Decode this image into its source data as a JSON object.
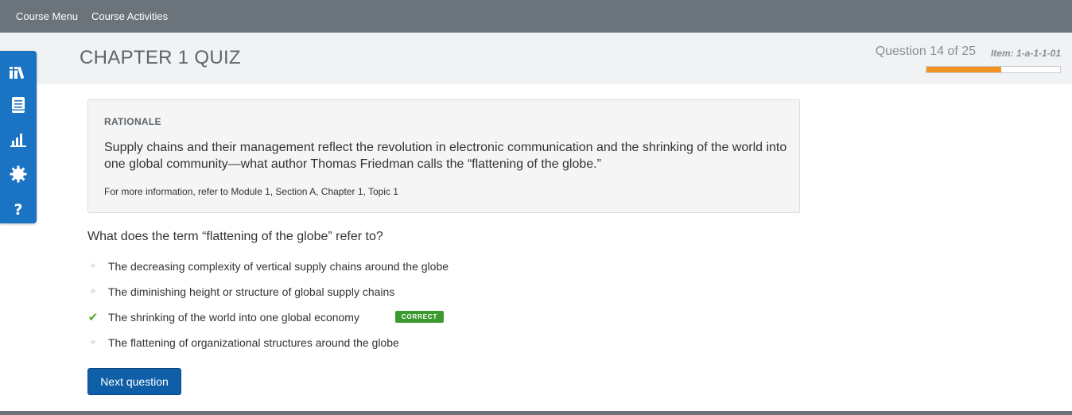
{
  "nav": {
    "course_menu": "Course Menu",
    "course_activities": "Course Activities"
  },
  "header": {
    "title": "CHAPTER 1 QUIZ",
    "progress_text": "Question 14 of 25",
    "item_id": "Item: 1-a-1-1-01",
    "progress_fraction": 0.56,
    "progress_color": "#f39220"
  },
  "sidebar": {
    "icons": [
      "library-icon",
      "notebook-icon",
      "bar-chart-icon",
      "gear-icon",
      "help-icon"
    ],
    "accent": "#1a73c3"
  },
  "rationale": {
    "heading": "RATIONALE",
    "body": "Supply chains and their management reflect the revolution in electronic communication and the shrinking of the world into one global community—what author Thomas Friedman calls the “flattening of the globe.”",
    "reference": "For more information, refer to Module 1, Section A, Chapter 1, Topic 1"
  },
  "question": {
    "text": "What does the term “flattening of the globe” refer to?",
    "answers": [
      {
        "label": "The decreasing complexity of vertical supply chains around the globe",
        "correct": false
      },
      {
        "label": "The diminishing height or structure of global supply chains",
        "correct": false
      },
      {
        "label": "The shrinking of the world into one global economy",
        "correct": true
      },
      {
        "label": "The flattening of organizational structures around the globe",
        "correct": false
      }
    ],
    "correct_badge": "CORRECT"
  },
  "actions": {
    "next_label": "Next question"
  }
}
